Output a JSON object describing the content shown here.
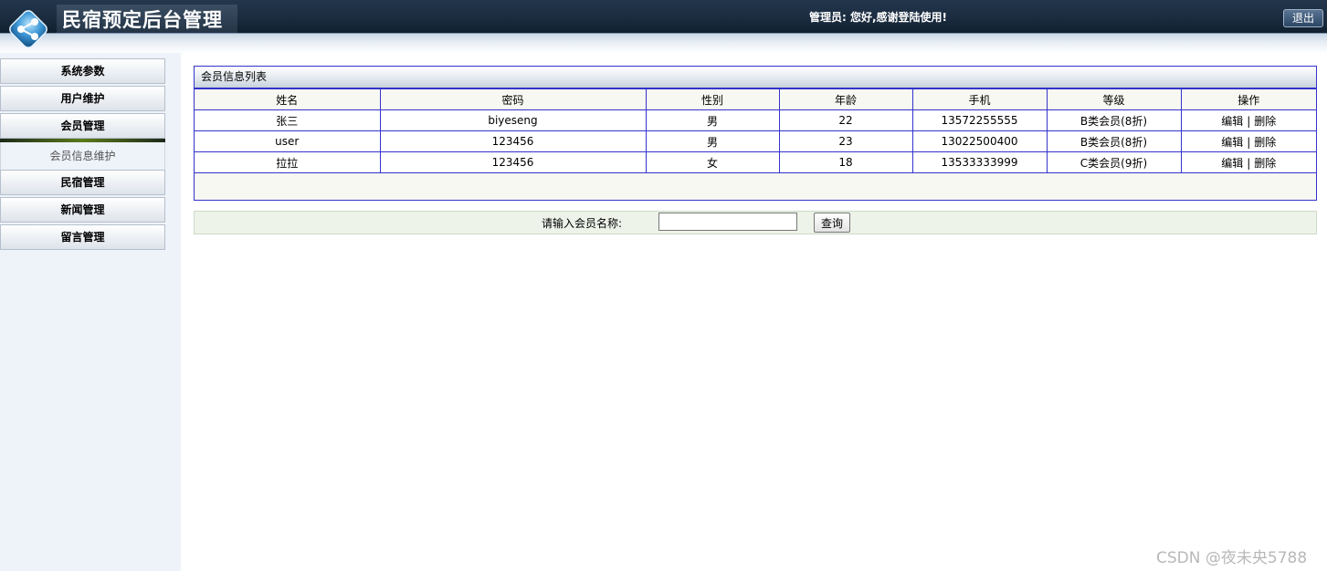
{
  "header": {
    "title": "民宿预定后台管理",
    "admin_text": "管理员:  您好,感谢登陆使用!",
    "logout_label": "退出",
    "logo_icon": "share-network-icon"
  },
  "sidebar": {
    "items": [
      {
        "label": "系统参数"
      },
      {
        "label": "用户维护"
      },
      {
        "label": "会员管理"
      }
    ],
    "sub_item": "会员信息维护",
    "items_after": [
      {
        "label": "民宿管理"
      },
      {
        "label": "新闻管理"
      },
      {
        "label": "留言管理"
      }
    ]
  },
  "panel": {
    "title": "会员信息列表",
    "columns": [
      "姓名",
      "密码",
      "性别",
      "年龄",
      "手机",
      "等级",
      "操作"
    ],
    "rows": [
      {
        "name": "张三",
        "password": "biyeseng",
        "gender": "男",
        "age": "22",
        "phone": "13572255555",
        "level": "B类会员(8折)"
      },
      {
        "name": "user",
        "password": "123456",
        "gender": "男",
        "age": "23",
        "phone": "13022500400",
        "level": "B类会员(8折)"
      },
      {
        "name": "拉拉",
        "password": "123456",
        "gender": "女",
        "age": "18",
        "phone": "13533333999",
        "level": "C类会员(9折)"
      }
    ],
    "edit_label": "编辑",
    "separator": "|",
    "delete_label": "删除"
  },
  "search": {
    "label": "请输入会员名称:",
    "value": "",
    "button_label": "查询"
  },
  "watermark": "CSDN @夜未央5788"
}
